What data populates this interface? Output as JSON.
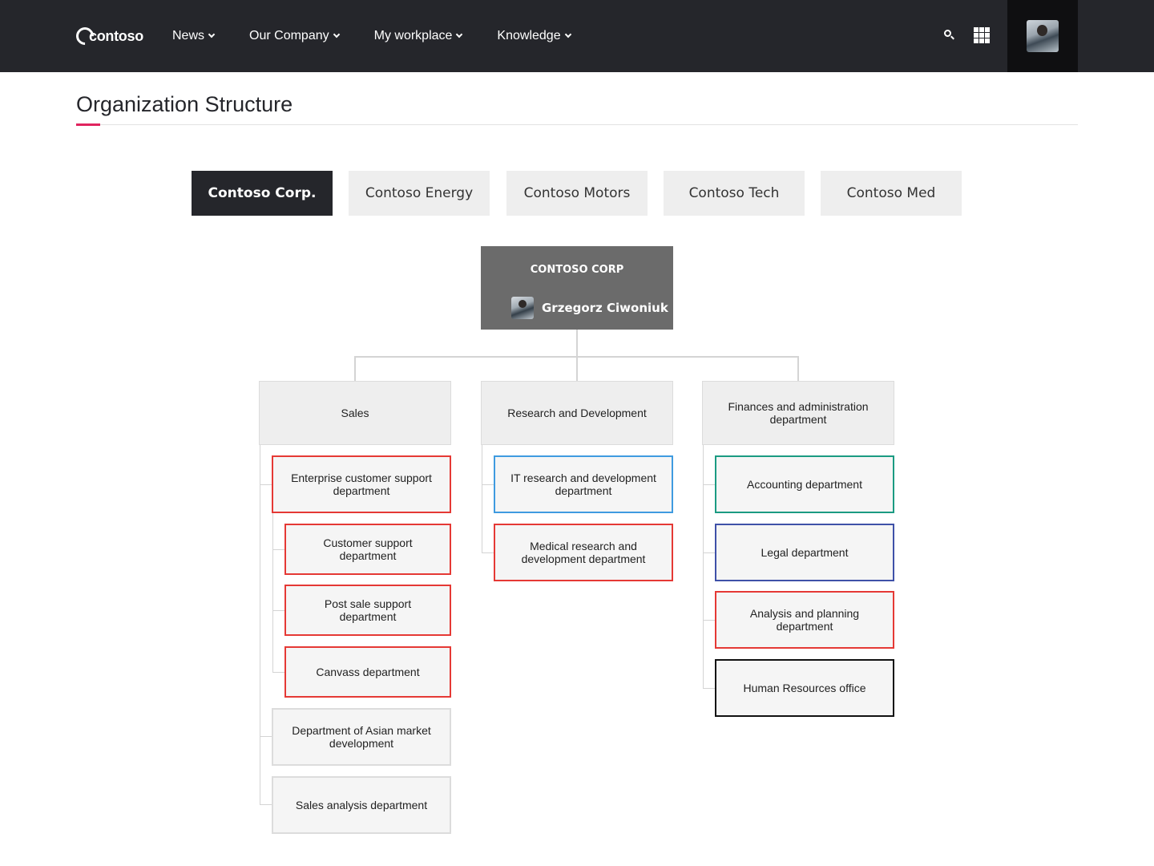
{
  "header": {
    "logo_text": "contoso",
    "nav": [
      {
        "label": "News"
      },
      {
        "label": "Our Company"
      },
      {
        "label": "My workplace"
      },
      {
        "label": "Knowledge"
      }
    ]
  },
  "page": {
    "title": "Organization Structure",
    "accent_color": "#e0245e"
  },
  "tabs": [
    {
      "label": "Contoso Corp.",
      "active": true
    },
    {
      "label": "Contoso Energy",
      "active": false
    },
    {
      "label": "Contoso Motors",
      "active": false
    },
    {
      "label": "Contoso Tech",
      "active": false
    },
    {
      "label": "Contoso Med",
      "active": false
    }
  ],
  "org": {
    "root": {
      "title": "CONTOSO CORP",
      "manager": "Grzegorz Ciwoniuk"
    },
    "departments": [
      {
        "name": "Sales",
        "children": [
          {
            "name": "Enterprise customer support department",
            "color": "#e53935",
            "children": [
              {
                "name": "Customer support department",
                "color": "#e53935"
              },
              {
                "name": "Post sale support department",
                "color": "#e53935"
              },
              {
                "name": "Canvass department",
                "color": "#e53935"
              }
            ]
          },
          {
            "name": "Department of Asian market development",
            "color": "#dcdcdc"
          },
          {
            "name": "Sales analysis department",
            "color": "#dcdcdc"
          }
        ]
      },
      {
        "name": "Research and Development",
        "children": [
          {
            "name": "IT research and development department",
            "color": "#3f9be0"
          },
          {
            "name": "Medical research and development department",
            "color": "#e53935"
          }
        ]
      },
      {
        "name": "Finances and administration department",
        "children": [
          {
            "name": "Accounting department",
            "color": "#1b9b82"
          },
          {
            "name": "Legal department",
            "color": "#3f51a8"
          },
          {
            "name": "Analysis and planning department",
            "color": "#e53935"
          },
          {
            "name": "Human Resources office",
            "color": "#111111"
          }
        ]
      }
    ]
  }
}
